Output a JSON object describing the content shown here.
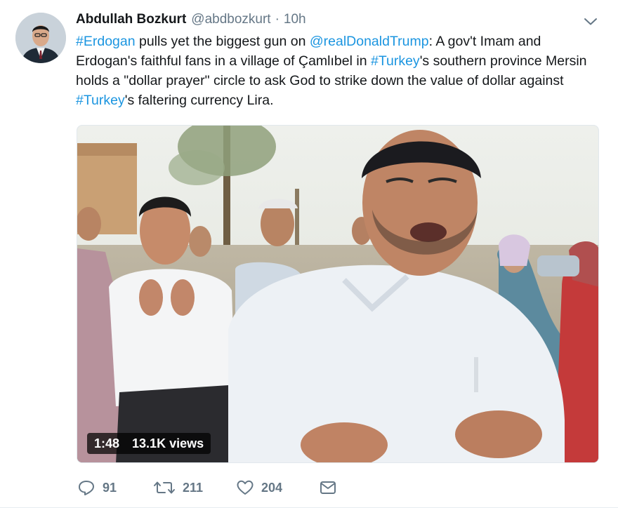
{
  "tweet": {
    "author_name": "Abdullah Bozkurt",
    "handle": "@abdbozkurt",
    "separator": "·",
    "time": "10h",
    "text": {
      "hashtag_erdogan": "#Erdogan",
      "part1": " pulls yet the biggest gun on ",
      "mention_trump": "@realDonaldTrump",
      "part2": ": A gov't Imam and Erdogan's faithful fans in a village of Çamlıbel in ",
      "hashtag_turkey_1": "#Turkey",
      "part3": "'s southern province Mersin holds a \"dollar prayer\" circle to ask God to strike down the value of dollar against ",
      "hashtag_turkey_2": "#Turkey",
      "part4": "'s faltering currency Lira."
    },
    "video": {
      "duration": "1:48",
      "views": "13.1K views"
    },
    "actions": {
      "replies": "91",
      "retweets": "211",
      "likes": "204"
    },
    "icons": {
      "menu": "chevron-down-icon",
      "reply": "reply-icon",
      "retweet": "retweet-icon",
      "like": "heart-icon",
      "dm": "envelope-icon"
    },
    "colors": {
      "link": "#1b95e0",
      "text": "#14171a",
      "meta": "#657786"
    }
  }
}
